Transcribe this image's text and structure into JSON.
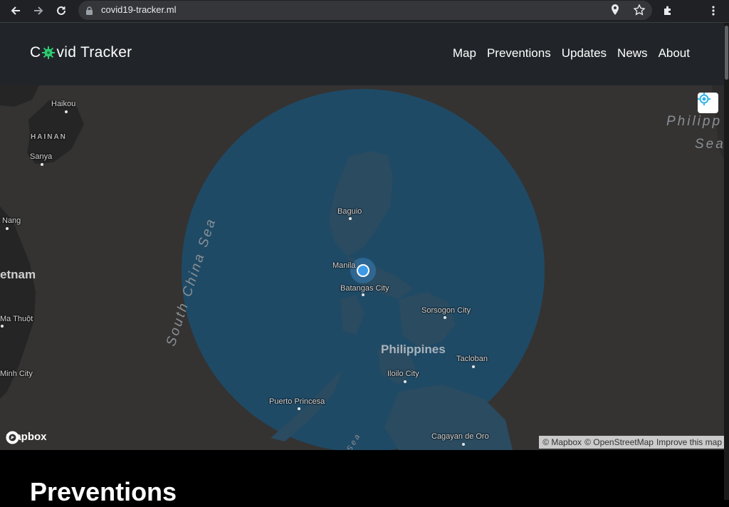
{
  "browser": {
    "url": "covid19-tracker.ml"
  },
  "navbar": {
    "brand_prefix": "C",
    "brand_suffix": "vid Tracker",
    "links": [
      "Map",
      "Preventions",
      "Updates",
      "News",
      "About"
    ]
  },
  "map": {
    "labels": {
      "haikou": "Haikou",
      "hainan": "HAINAN",
      "sanya": "Sanya",
      "nang": "Nang",
      "vietnam": "etnam",
      "ma_thuot": "Ma Thuột",
      "minh_city": "Minh City",
      "south_china_sea": "South China Sea",
      "philippine_sea_1": "Philipp",
      "philippine_sea_2": "Sea",
      "baguio": "Baguio",
      "manila": "Manila",
      "batangas": "Batangas City",
      "sorsogon": "Sorsogon City",
      "philippines": "Philippines",
      "tacloban": "Tacloban",
      "iloilo": "Iloilo City",
      "puerto_princesa": "Puerto Princesa",
      "cagayan": "Cagayan de Oro",
      "sea_bottom": "Sea"
    },
    "logo_text": "mapbox",
    "attribution": {
      "mapbox": "© Mapbox",
      "osm": "© OpenStreetMap",
      "improve": "Improve this map"
    },
    "colors": {
      "background": "#343332",
      "radius_circle": "#1f4a66",
      "user_dot": "#3d9ae8"
    }
  },
  "sections": {
    "preventions_title": "Preventions"
  }
}
